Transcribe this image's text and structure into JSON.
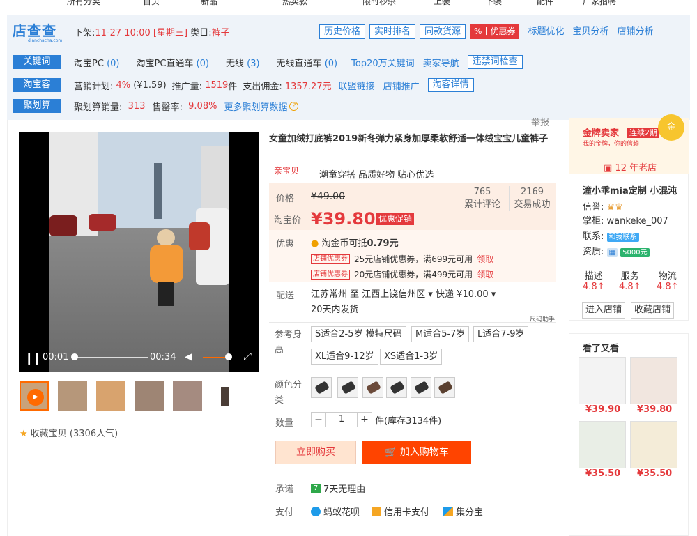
{
  "top_nav": [
    "所有分类",
    "首页",
    "新品",
    "热卖款",
    "限时秒杀",
    "上装",
    "下装",
    "配件",
    "厂家招聘"
  ],
  "ext": {
    "logo": "店查查",
    "logo_sub": "dianchacha.com",
    "shelf_label": "下架:",
    "shelf_time": "11-27 10:00 [星期三]",
    "category_label": "类目:",
    "category": "裤子",
    "buttons": [
      "历史价格",
      "实时排名",
      "同款货源"
    ],
    "coupon_btn": "%丨优惠券",
    "links": [
      "标题优化",
      "宝贝分析",
      "店铺分析"
    ],
    "keyword_row": {
      "tag": "关键词",
      "items": [
        {
          "label": "淘宝PC",
          "count": "(0)"
        },
        {
          "label": "淘宝PC直通车",
          "count": "(0)"
        },
        {
          "label": "无线",
          "count": "(3)"
        },
        {
          "label": "无线直通车",
          "count": "(0)"
        }
      ],
      "top20": "Top20万关键词",
      "nav": "卖家导航",
      "check": "违禁词检查"
    },
    "taoke_row": {
      "tag": "淘宝客",
      "plan_label": "营销计划:",
      "plan_pct": "4%",
      "plan_amt": "(¥1.59)",
      "promo_label": "推广量:",
      "promo_num": "1519",
      "promo_unit": "件",
      "comm_label": "支出佣金:",
      "comm_val": "1357.27元",
      "link1": "联盟链接",
      "link2": "店铺推广",
      "detail": "淘客详情"
    },
    "juhua_row": {
      "tag": "聚划算",
      "sales_label": "聚划算销量:",
      "sales_val": "313",
      "rate_label": "售罄率:",
      "rate_val": "9.08%",
      "more": "更多聚划算数据"
    }
  },
  "report": "举报",
  "video": {
    "current": "00:01",
    "total": "00:34",
    "progress": 0.03,
    "volume": 0.85
  },
  "favorite": "收藏宝贝 (3306人气)",
  "product": {
    "title": "女童加绒打底裤2019新冬弹力紧身加厚柔软舒适一体绒宝宝儿童裤子",
    "badge": "亲宝贝",
    "slogan": "潮童穿搭 品质好物 贴心优选",
    "price_label": "价格",
    "old_price": "¥49.00",
    "tb_label": "淘宝价",
    "price": "¥39.80",
    "promo": "优惠促销",
    "reviews": "765",
    "reviews_label": "累计评论",
    "deals": "2169",
    "deals_label": "交易成功",
    "youhui_label": "优惠",
    "coin": "淘金币可抵",
    "coin_val": "0.79元",
    "coupons": [
      {
        "tag": "店铺优惠券",
        "text": "25元店铺优惠券，满699元可用",
        "get": "领取"
      },
      {
        "tag": "店铺优惠券",
        "text": "20元店铺优惠券，满499元可用",
        "get": "领取"
      }
    ],
    "ship_label": "配送",
    "ship_line": "江苏常州 至  江西上饶信州区 ▾  快递 ¥10.00 ▾",
    "ship_days": "20天内发货",
    "size_tip": "尺码助手",
    "size_label": "参考身高",
    "sizes_row1": [
      "S适合2-5岁 模特尺码",
      "M适合5-7岁",
      "L适合7-9岁"
    ],
    "sizes_row2": [
      "XL适合9-12岁",
      "XS适合1-3岁"
    ],
    "color_label": "颜色分类",
    "qty_label": "数量",
    "qty": "1",
    "stock": "件(库存3134件)",
    "buy": "立即购买",
    "cart": "加入购物车",
    "promise_label": "承诺",
    "promise": "7天无理由",
    "pay_label": "支付",
    "pay": [
      "蚂蚁花呗",
      "信用卡支付",
      "集分宝"
    ]
  },
  "shop": {
    "gold": "金牌卖家",
    "gold_sub": "我的金牌，你的信赖",
    "streak": "连续2期",
    "medal": "金",
    "years": "12 年老店",
    "name": "潼小乖mia定制 小混沌",
    "credit_label": "信誉:",
    "keeper_label": "掌柜:",
    "keeper": "wankeke_007",
    "contact_label": "联系:",
    "contact": "和我联系",
    "qual_label": "资质:",
    "qual": "5000元",
    "ratings": [
      {
        "label": "描述",
        "val": "4.8"
      },
      {
        "label": "服务",
        "val": "4.8"
      },
      {
        "label": "物流",
        "val": "4.8"
      }
    ],
    "enter": "进入店铺",
    "collect": "收藏店铺"
  },
  "see_also": {
    "title": "看了又看",
    "prices": [
      "¥39.90",
      "¥39.80",
      "¥35.50",
      "¥35.50"
    ]
  },
  "colors": {
    "accent": "#2b7fd6",
    "price": "#e4393c",
    "cart": "#ff4400"
  }
}
